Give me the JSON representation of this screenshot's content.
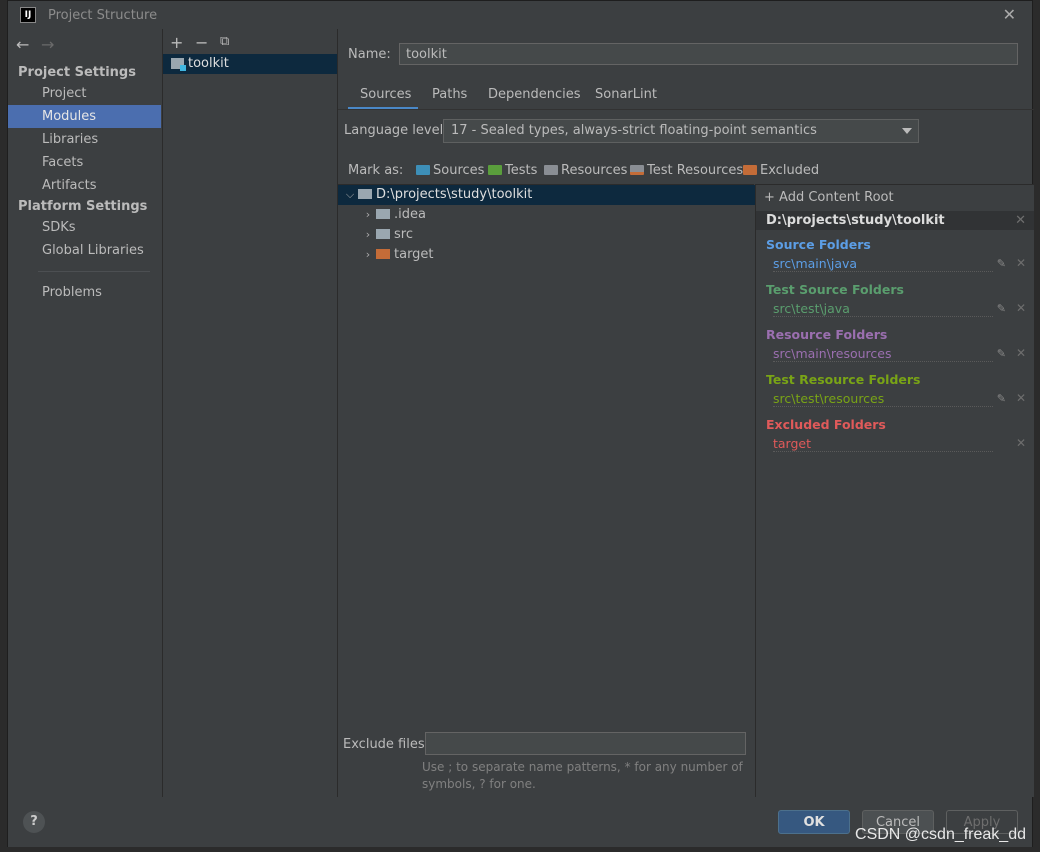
{
  "window": {
    "title": "Project Structure",
    "close": "✕"
  },
  "nav": {
    "back": "←",
    "forward": "→"
  },
  "sidebar": {
    "project_settings_title": "Project Settings",
    "project_items": [
      {
        "label": "Project"
      },
      {
        "label": "Modules",
        "selected": true
      },
      {
        "label": "Libraries"
      },
      {
        "label": "Facets"
      },
      {
        "label": "Artifacts"
      }
    ],
    "platform_settings_title": "Platform Settings",
    "platform_items": [
      {
        "label": "SDKs"
      },
      {
        "label": "Global Libraries"
      }
    ],
    "problems_label": "Problems"
  },
  "modules": {
    "toolbar": {
      "add": "+",
      "remove": "−",
      "copy": "⧉"
    },
    "items": [
      {
        "label": "toolkit",
        "selected": true
      }
    ]
  },
  "details": {
    "name_label": "Name:",
    "name_value": "toolkit",
    "tabs": [
      {
        "label": "Sources",
        "active": true
      },
      {
        "label": "Paths"
      },
      {
        "label": "Dependencies"
      },
      {
        "label": "SonarLint"
      }
    ],
    "language_level_label": "Language level:",
    "language_level_value": "17 - Sealed types, always-strict floating-point semantics",
    "mark_as_label": "Mark as:",
    "mark_as": [
      {
        "label": "Sources",
        "color": "#3d8fb8"
      },
      {
        "label": "Tests",
        "color": "#5a9e3c"
      },
      {
        "label": "Resources",
        "color": "#8a8e94"
      },
      {
        "label": "Test Resources",
        "color": "#8a8e94"
      },
      {
        "label": "Excluded",
        "color": "#c46c38"
      }
    ],
    "tree": [
      {
        "label": "D:\\projects\\study\\toolkit",
        "expanded": true,
        "selected": true,
        "color": "#9aa7b0"
      },
      {
        "label": ".idea",
        "color": "#9aa7b0"
      },
      {
        "label": "src",
        "color": "#9aa7b0"
      },
      {
        "label": "target",
        "color": "#c46c38"
      }
    ],
    "exclude_files_label": "Exclude files:",
    "exclude_files_value": "",
    "hint_line1": "Use ; to separate name patterns, * for any number of",
    "hint_line2": "symbols, ? for one."
  },
  "content_roots": {
    "add_label": "+ Add Content Root",
    "root_path": "D:\\projects\\study\\toolkit",
    "groups": [
      {
        "title": "Source Folders",
        "path": "src\\main\\java",
        "color": "#5c9ee6",
        "edit": true
      },
      {
        "title": "Test Source Folders",
        "path": "src\\test\\java",
        "color": "#5a9e6e",
        "edit": true
      },
      {
        "title": "Resource Folders",
        "path": "src\\main\\resources",
        "color": "#9b6fb0",
        "edit": true
      },
      {
        "title": "Test Resource Folders",
        "path": "src\\test\\resources",
        "color": "#79a416",
        "edit": true
      },
      {
        "title": "Excluded Folders",
        "path": "target",
        "color": "#e05a5a",
        "edit": false
      }
    ]
  },
  "footer": {
    "help": "?",
    "ok": "OK",
    "cancel": "Cancel",
    "apply": "Apply",
    "watermark": "CSDN @csdn_freak_dd"
  }
}
